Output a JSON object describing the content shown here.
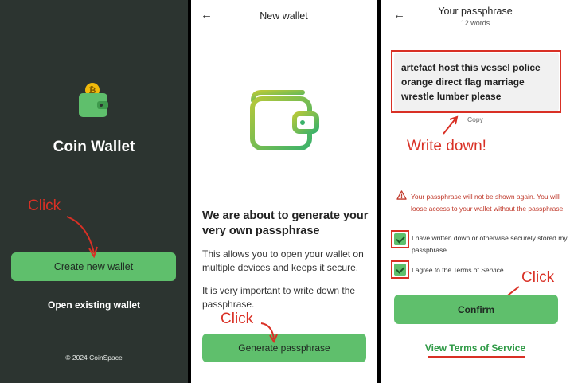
{
  "panel1": {
    "app_title": "Coin Wallet",
    "create_button": "Create new wallet",
    "open_link": "Open existing wallet",
    "copyright": "© 2024 CoinSpace"
  },
  "panel2": {
    "back_icon": "←",
    "header": "New wallet",
    "heading": "We are about to generate your very own passphrase",
    "para1": "This allows you to open your wallet on multiple devices and keeps it secure.",
    "para2": "It is very important to write down the passphrase.",
    "generate_button": "Generate passphrase"
  },
  "panel3": {
    "back_icon": "←",
    "header": "Your passphrase",
    "subheader": "12 words",
    "passphrase": "artefact host this vessel police orange direct flag marriage wrestle lumber please",
    "copy_label": "Copy",
    "warning": "Your passphrase will not be shown again. You will loose access to your wallet without the passphrase.",
    "check1_label": "I have written down or otherwise securely stored my passphrase",
    "check2_label": "I agree to the Terms of Service",
    "confirm_button": "Confirm",
    "tos_link": "View Terms of Service"
  },
  "annotations": {
    "click1": "Click",
    "click2": "Click",
    "write_down": "Write down!",
    "click3": "Click"
  },
  "colors": {
    "dark_bg": "#2c3430",
    "accent_green": "#5fbf6c",
    "annotation_red": "#d93025"
  }
}
